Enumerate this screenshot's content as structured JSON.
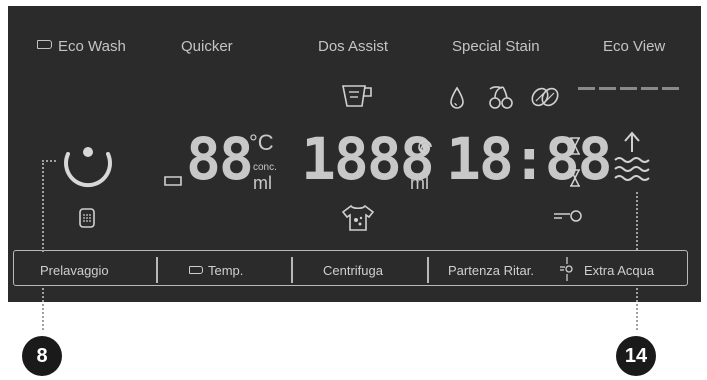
{
  "modes": {
    "eco_wash": "Eco Wash",
    "quicker": "Quicker",
    "dos_assist": "Dos Assist",
    "special_stain": "Special Stain",
    "eco_view": "Eco View"
  },
  "display": {
    "temperature_digits": "88",
    "temperature_unit": "°C",
    "conc_label": "conc.",
    "ml_label_left": "ml",
    "center_digits": "1888",
    "ml_label_center": "ml",
    "time_digits": "18:88"
  },
  "buttons": {
    "prelavaggio": "Prelavaggio",
    "temp": "Temp.",
    "centrifuga": "Centrifuga",
    "partenza_ritar": "Partenza Ritar.",
    "extra_acqua": "Extra Acqua"
  },
  "callouts": {
    "left": "8",
    "right": "14"
  },
  "colors": {
    "panel": "#2b2b2b",
    "segment": "#c8c8c8",
    "callout_bg": "#1a1a1a"
  },
  "icons": [
    "tag-icon",
    "measuring-cup-icon",
    "drop-icon",
    "cherries-icon",
    "leaf-icon",
    "power-dial-icon",
    "drum-icon",
    "shirt-stain-icon",
    "spiral-icon",
    "hourglass-icon",
    "key-icon",
    "waves-arrow-icon"
  ]
}
